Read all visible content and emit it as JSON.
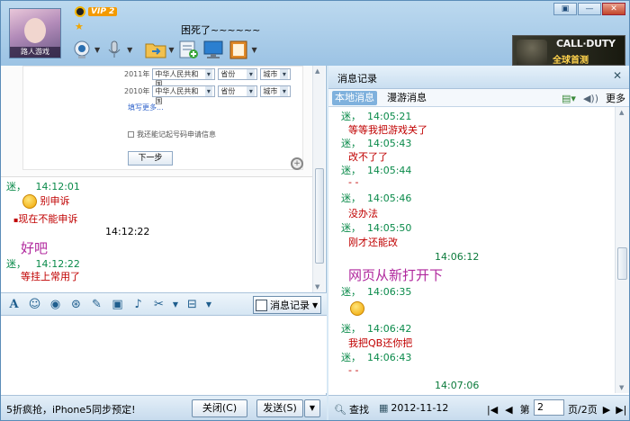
{
  "header": {
    "avatar_caption": "路人游戏",
    "vip_label": "VIP 2",
    "signature": "困死了~~~~~~",
    "ad_title": "CALL·DUTY",
    "ad_subtitle": "全球首测"
  },
  "window_buttons": [
    "▣",
    "—",
    "✕"
  ],
  "preview": {
    "rows": [
      {
        "year": "2011年",
        "country": "中华人民共和国",
        "province": "省份",
        "city": "城市"
      },
      {
        "year": "2010年",
        "country": "中华人民共和国",
        "province": "省份",
        "city": "城市"
      }
    ],
    "more": "填写更多...",
    "checkbox_label": "我还能记起号码申请信息",
    "next_button": "下一步"
  },
  "chat": [
    {
      "nick": "迷，",
      "time": "14:12:01"
    },
    {
      "text": "别申诉"
    },
    {
      "text": "现在不能申诉"
    },
    {
      "center_time": "14:12:22"
    },
    {
      "text": "好吧"
    },
    {
      "nick": "迷，",
      "time": "14:12:22"
    },
    {
      "text": "等挂上常用了"
    }
  ],
  "history_button": "消息记录",
  "bottom": {
    "promo": "5折疯抢，iPhone5同步预定!",
    "close": "关闭(C)",
    "send": "发送(S)"
  },
  "history": {
    "title": "消息记录",
    "tab_local": "本地消息",
    "tab_roam": "漫游消息",
    "more": "更多",
    "log": [
      {
        "nick": "迷，",
        "time": "14:05:21"
      },
      {
        "text": "等等我把游戏关了"
      },
      {
        "nick": "迷，",
        "time": "14:05:43"
      },
      {
        "text": "改不了了"
      },
      {
        "nick": "迷，",
        "time": "14:05:44"
      },
      {
        "text": "- -"
      },
      {
        "nick": "迷，",
        "time": "14:05:46"
      },
      {
        "text": "没办法"
      },
      {
        "nick": "迷，",
        "time": "14:05:50"
      },
      {
        "text": "刚才还能改"
      },
      {
        "center_time": "14:06:12"
      },
      {
        "text": "网页从新打开下"
      },
      {
        "nick": "迷，",
        "time": "14:06:35"
      },
      {
        "emoji": "smile"
      },
      {
        "nick": "迷，",
        "time": "14:06:42"
      },
      {
        "text": "我把QB还你把"
      },
      {
        "nick": "迷，",
        "time": "14:06:43"
      },
      {
        "text": "- -"
      },
      {
        "center_time": "14:07:06"
      }
    ],
    "search": "查找",
    "date": "2012-11-12",
    "page_prefix": "第",
    "page_value": "2",
    "page_suffix": "页/2页"
  }
}
